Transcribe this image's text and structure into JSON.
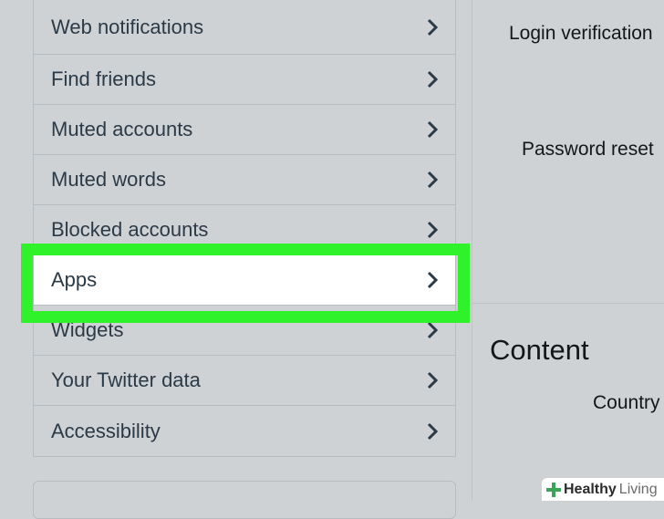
{
  "sidebar": {
    "items": [
      {
        "label": "Web notifications"
      },
      {
        "label": "Find friends"
      },
      {
        "label": "Muted accounts"
      },
      {
        "label": "Muted words"
      },
      {
        "label": "Blocked accounts"
      },
      {
        "label": "Apps",
        "state": "highlighted"
      },
      {
        "label": "Widgets"
      },
      {
        "label": "Your Twitter data"
      },
      {
        "label": "Accessibility"
      }
    ],
    "chevron_icon": "chevron-right-icon",
    "highlight_color": "#2ff22a"
  },
  "main": {
    "login_verification_label": "Login verification",
    "password_reset_label": "Password reset",
    "content_heading": "Content",
    "country_label": "Country"
  },
  "watermark": {
    "part1": "Healthy",
    "part2": "Living",
    "icon": "plus-leaf-icon"
  }
}
